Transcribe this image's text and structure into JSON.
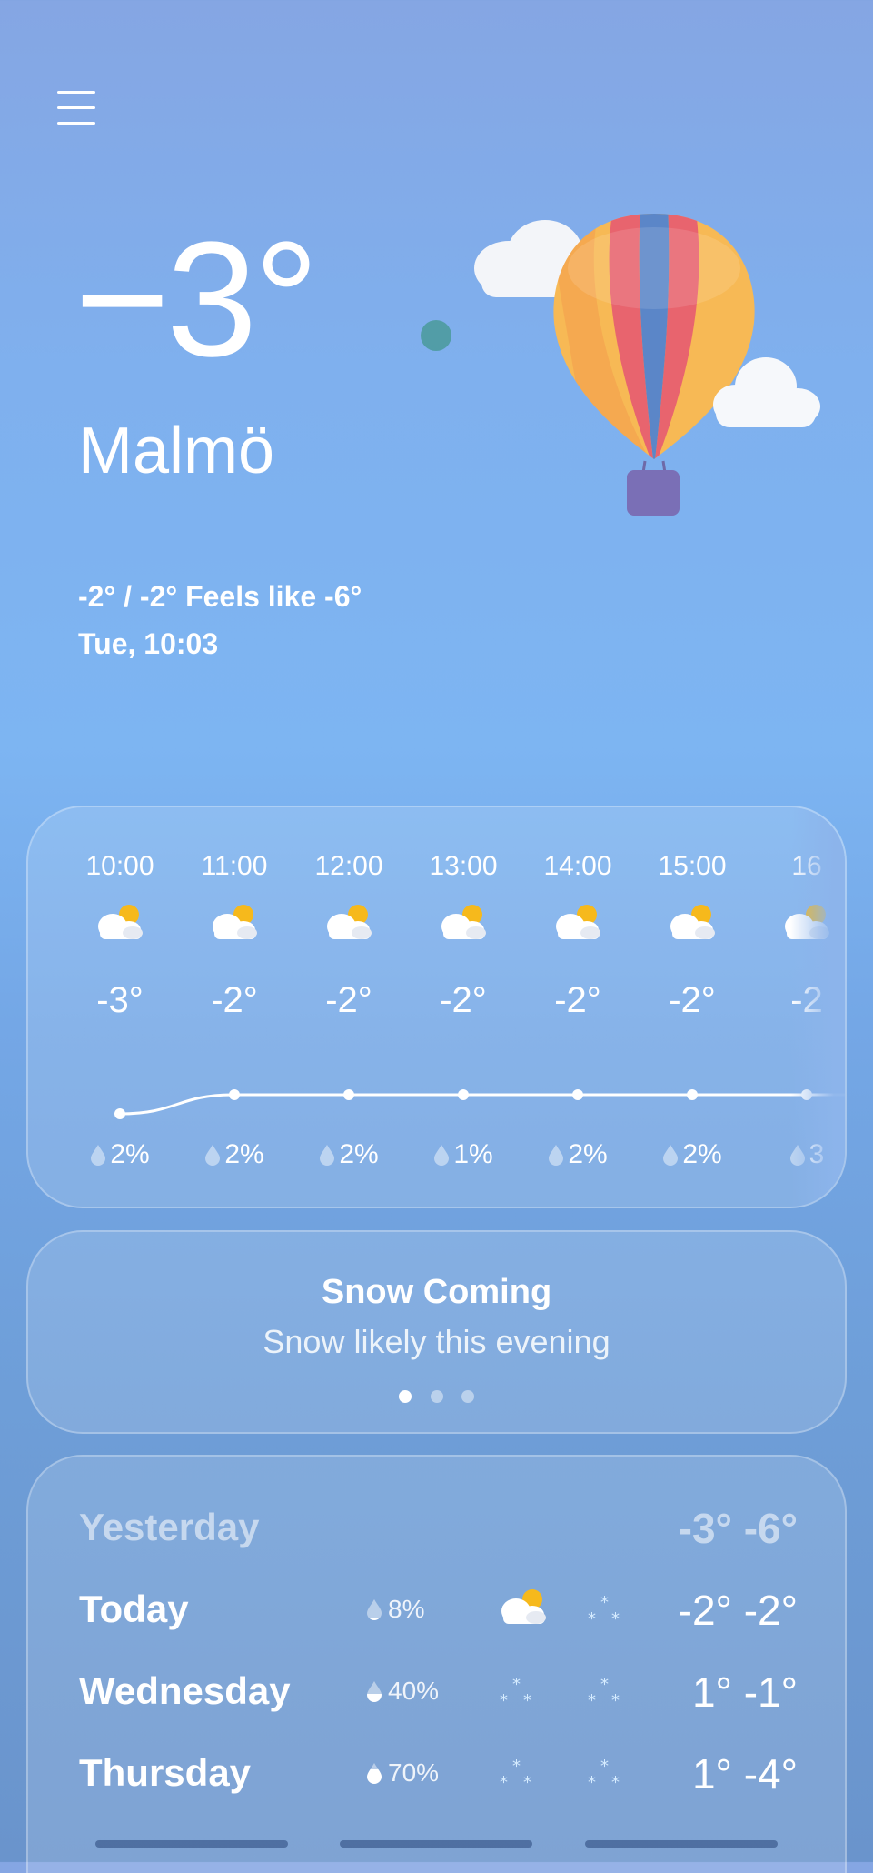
{
  "current": {
    "temp": "−3°",
    "city": "Malmö",
    "feels_line": "-2° / -2° Feels like -6°",
    "datetime": "Tue, 10:03"
  },
  "hourly": [
    {
      "time": "10:00",
      "temp": "-3°",
      "precip": "2%",
      "icon": "partly-cloudy-icon",
      "precip_value": 2
    },
    {
      "time": "11:00",
      "temp": "-2°",
      "precip": "2%",
      "icon": "partly-cloudy-icon",
      "precip_value": 2
    },
    {
      "time": "12:00",
      "temp": "-2°",
      "precip": "2%",
      "icon": "partly-cloudy-icon",
      "precip_value": 2
    },
    {
      "time": "13:00",
      "temp": "-2°",
      "precip": "1%",
      "icon": "partly-cloudy-icon",
      "precip_value": 1
    },
    {
      "time": "14:00",
      "temp": "-2°",
      "precip": "2%",
      "icon": "partly-cloudy-icon",
      "precip_value": 2
    },
    {
      "time": "15:00",
      "temp": "-2°",
      "precip": "2%",
      "icon": "partly-cloudy-icon",
      "precip_value": 2
    },
    {
      "time": "16",
      "temp": "-2",
      "precip": "3",
      "icon": "partly-cloudy-icon",
      "precip_value": 3
    }
  ],
  "hourly_temps": [
    -3,
    -2,
    -2,
    -2,
    -2,
    -2,
    -2
  ],
  "alert": {
    "title": "Snow Coming",
    "subtitle": "Snow likely this evening",
    "page_count": 3,
    "active_page": 0
  },
  "daily": [
    {
      "name": "Yesterday",
      "precip": "",
      "icon_day": "",
      "icon_night": "",
      "temps": "-3° -6°"
    },
    {
      "name": "Today",
      "precip": "8%",
      "icon_day": "partly-cloudy-icon",
      "icon_night": "snow-icon",
      "temps": "-2° -2°"
    },
    {
      "name": "Wednesday",
      "precip": "40%",
      "icon_day": "snow-icon",
      "icon_night": "snow-icon",
      "temps": "1°  -1°"
    },
    {
      "name": "Thursday",
      "precip": "70%",
      "icon_day": "snow-icon",
      "icon_night": "snow-icon",
      "temps": "1°  -4°"
    }
  ],
  "colors": {
    "sky_top": "#85a6e3",
    "balloon_red": "#e8646e",
    "balloon_yellow": "#f7c24a",
    "balloon_blue": "#5b86c8",
    "sun": "#f6b91c"
  }
}
